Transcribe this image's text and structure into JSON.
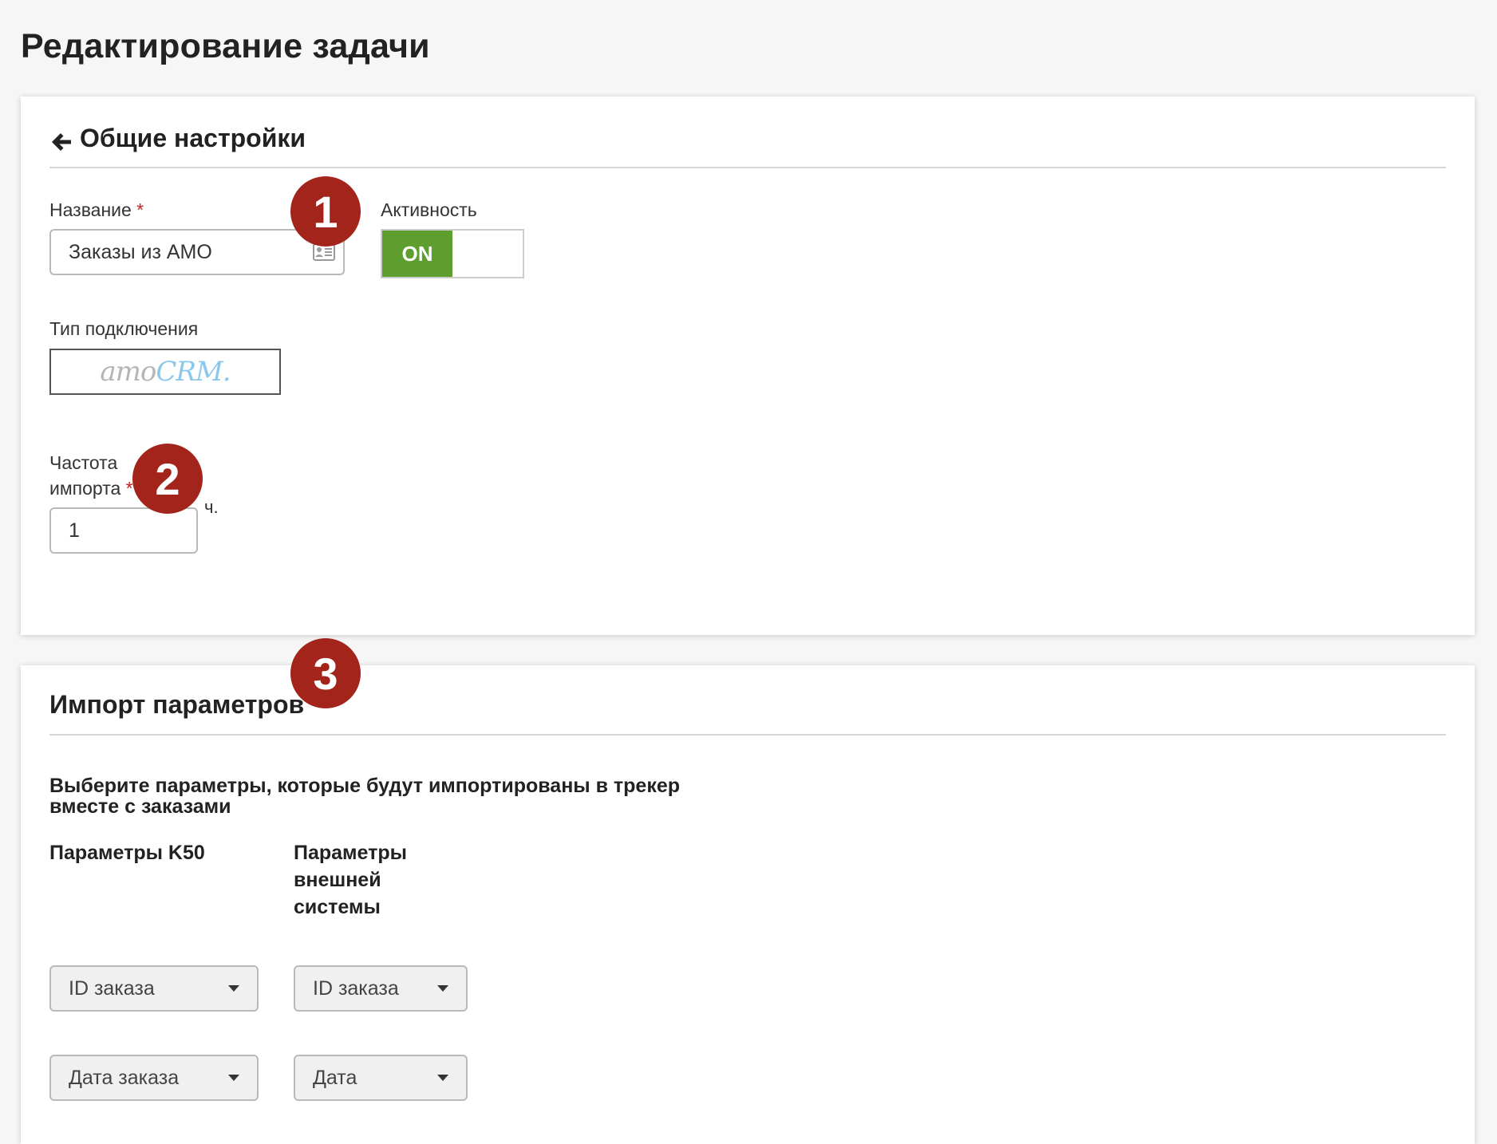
{
  "page": {
    "title": "Редактирование задачи"
  },
  "general_settings": {
    "back_icon": "arrow-left-icon",
    "title": "Общие настройки",
    "name_field": {
      "label": "Название",
      "required_mark": "*",
      "value": "Заказы из АМО",
      "icon": "contact-card-icon"
    },
    "activity": {
      "label": "Активность",
      "state_label": "ON"
    },
    "connection_type": {
      "label": "Тип подключения",
      "logo_part_1": "amo",
      "logo_part_2": "CRM."
    },
    "import_frequency": {
      "label_line1": "Частота",
      "label_line2": "импорта",
      "required_mark": "*",
      "value": "1",
      "unit": "ч."
    }
  },
  "import_params": {
    "title": "Импорт параметров",
    "description_line1": "Выберите параметры, которые будут импортированы в трекер",
    "description_line2": "вместе с заказами",
    "column_k50": "Параметры K50",
    "column_external_line1": "Параметры",
    "column_external_line2": "внешней",
    "column_external_line3": "системы",
    "rows": [
      {
        "k50": "ID заказа",
        "external": "ID заказа"
      },
      {
        "k50": "Дата заказа",
        "external": "Дата"
      }
    ]
  },
  "badges": [
    "1",
    "2",
    "3"
  ],
  "colors": {
    "toggle_on": "#5d9e2f",
    "badge": "#a3241b",
    "required": "#c81e1e",
    "amo_gray": "#b5b5b5",
    "crm_blue": "#8cc8ec"
  }
}
